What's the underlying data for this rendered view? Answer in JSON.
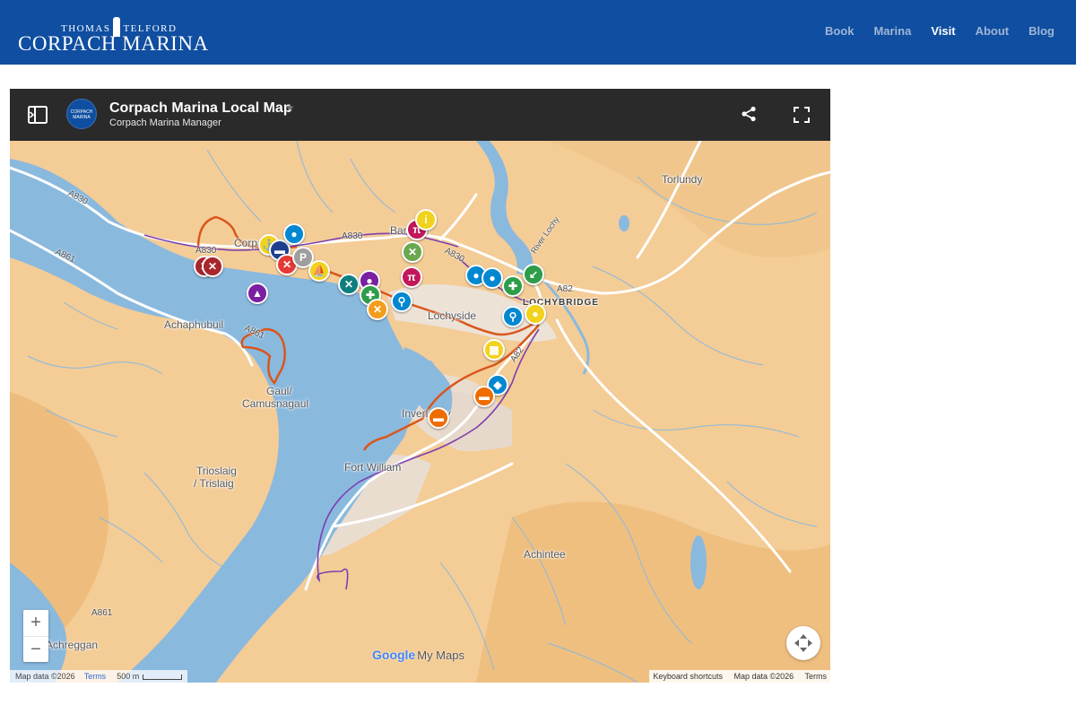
{
  "header": {
    "logo_top_left": "THOMAS",
    "logo_top_right": "TELFORD",
    "logo_main": "CORPACH MARINA",
    "nav": [
      {
        "label": "Book",
        "active": false
      },
      {
        "label": "Marina",
        "active": false
      },
      {
        "label": "Visit",
        "active": true
      },
      {
        "label": "About",
        "active": false
      },
      {
        "label": "Blog",
        "active": false
      }
    ]
  },
  "map": {
    "title": "Corpach Marina Local Map",
    "subtitle": "Corpach Marina Manager",
    "avatar_text_1": "CORPACH",
    "avatar_text_2": "MARINA",
    "icons": {
      "sidebar": "sidebar-toggle-icon",
      "star": "star-icon",
      "share": "share-icon",
      "fullscreen": "fullscreen-icon",
      "recenter": "recenter-icon"
    },
    "colors": {
      "water": "#8ab9de",
      "land": "#f4cc96",
      "urban": "#e9ddd0",
      "route_orange": "#d9561c",
      "route_purple": "#7d3fb0",
      "road": "#ffffff"
    },
    "places": [
      {
        "name": "Torlundy",
        "bold": false
      },
      {
        "name": "Corpach",
        "bold": false
      },
      {
        "name": "Banavie",
        "bold": false
      },
      {
        "name": "LOCHYBRIDGE",
        "bold": true
      },
      {
        "name": "Lochyside",
        "bold": false
      },
      {
        "name": "Achaphubuil",
        "bold": false
      },
      {
        "name": "Gaul/",
        "bold": false
      },
      {
        "name": "Camusnagaul",
        "bold": false
      },
      {
        "name": "Inverlochy",
        "bold": false
      },
      {
        "name": "Fort William",
        "bold": false
      },
      {
        "name": "Trioslaig",
        "bold": false
      },
      {
        "name": "/ Trislaig",
        "bold": false
      },
      {
        "name": "Achintee",
        "bold": false
      },
      {
        "name": "Achreggan",
        "bold": false
      }
    ],
    "roads": [
      "A830",
      "A861",
      "A830",
      "A830",
      "A830",
      "A861",
      "A82",
      "A82",
      "A861"
    ],
    "river_label": "River Lochy",
    "pins": [
      {
        "category": "tools",
        "color": "#a8262c"
      },
      {
        "category": "tools",
        "color": "#a8262c"
      },
      {
        "category": "marina",
        "color": "#f2d21c"
      },
      {
        "category": "hotel",
        "color": "#1e3f8f"
      },
      {
        "category": "location",
        "color": "#0288d1"
      },
      {
        "category": "food",
        "color": "#e53935"
      },
      {
        "category": "parking",
        "color": "#9e9e9e"
      },
      {
        "category": "sailing",
        "color": "#7b1fa2"
      },
      {
        "category": "boat",
        "color": "#f2d21c"
      },
      {
        "category": "walking",
        "color": "#0e7f7f"
      },
      {
        "category": "attraction",
        "color": "#7b1fa2"
      },
      {
        "category": "medical",
        "color": "#2e9d4a"
      },
      {
        "category": "shop",
        "color": "#f29d1b"
      },
      {
        "category": "toilets",
        "color": "#0288d1"
      },
      {
        "category": "playground",
        "color": "#c2185b"
      },
      {
        "category": "restaurant",
        "color": "#6aa84f"
      },
      {
        "category": "playground",
        "color": "#c2185b"
      },
      {
        "category": "info",
        "color": "#f2d21c"
      },
      {
        "category": "location",
        "color": "#0288d1"
      },
      {
        "category": "location",
        "color": "#0288d1"
      },
      {
        "category": "medical",
        "color": "#2e9d4a"
      },
      {
        "category": "direction",
        "color": "#2e9d4a"
      },
      {
        "category": "toilets",
        "color": "#0288d1"
      },
      {
        "category": "location",
        "color": "#f2d21c"
      },
      {
        "category": "castle",
        "color": "#f2d21c"
      },
      {
        "category": "shop",
        "color": "#0288d1"
      },
      {
        "category": "car",
        "color": "#ef6c00"
      },
      {
        "category": "car",
        "color": "#ef6c00"
      }
    ],
    "zoom_in": "+",
    "zoom_out": "−",
    "google_brand": "Google",
    "my_maps": "My Maps",
    "attribution_left": "Map data ©2026",
    "terms_left": "Terms",
    "scale": "500 m",
    "keyboard_shortcuts": "Keyboard shortcuts",
    "attribution_right": "Map data ©2026",
    "terms_right": "Terms"
  }
}
